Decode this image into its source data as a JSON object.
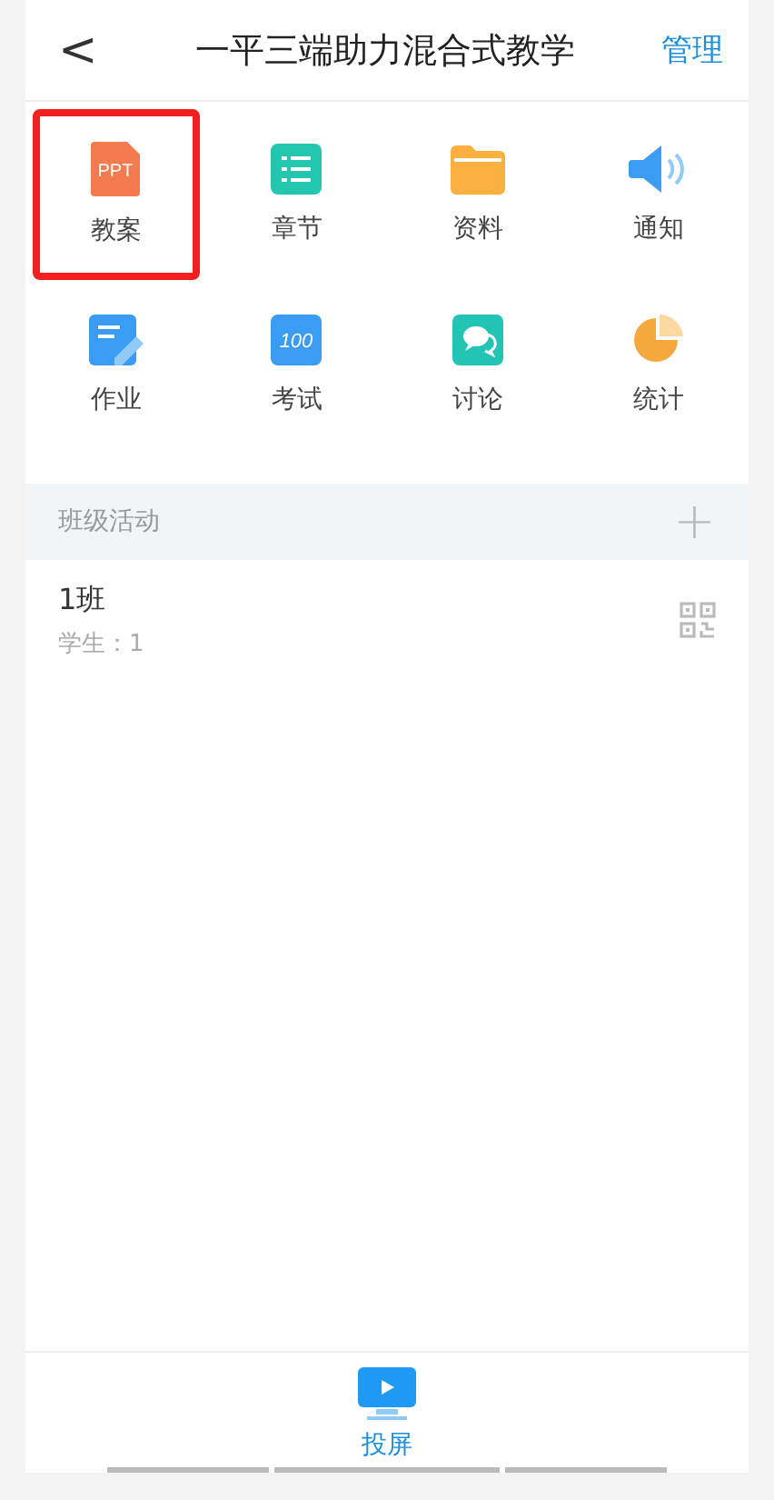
{
  "header": {
    "back": "<",
    "title": "一平三端助力混合式教学",
    "action": "管理"
  },
  "tiles": [
    {
      "kind": "ppt",
      "label": "教案",
      "icon_text": "PPT",
      "highlighted": true
    },
    {
      "kind": "list",
      "label": "章节",
      "highlighted": false
    },
    {
      "kind": "folder",
      "label": "资料",
      "highlighted": false
    },
    {
      "kind": "speaker",
      "label": "通知",
      "highlighted": false
    },
    {
      "kind": "note",
      "label": "作业",
      "highlighted": false
    },
    {
      "kind": "score",
      "label": "考试",
      "icon_text": "100",
      "highlighted": false
    },
    {
      "kind": "chat",
      "label": "讨论",
      "highlighted": false
    },
    {
      "kind": "pie",
      "label": "统计",
      "highlighted": false
    }
  ],
  "section": {
    "title": "班级活动",
    "add": "+"
  },
  "classes": [
    {
      "name": "1班",
      "detail": "学生：1"
    }
  ],
  "bottom": {
    "label": "投屏"
  }
}
